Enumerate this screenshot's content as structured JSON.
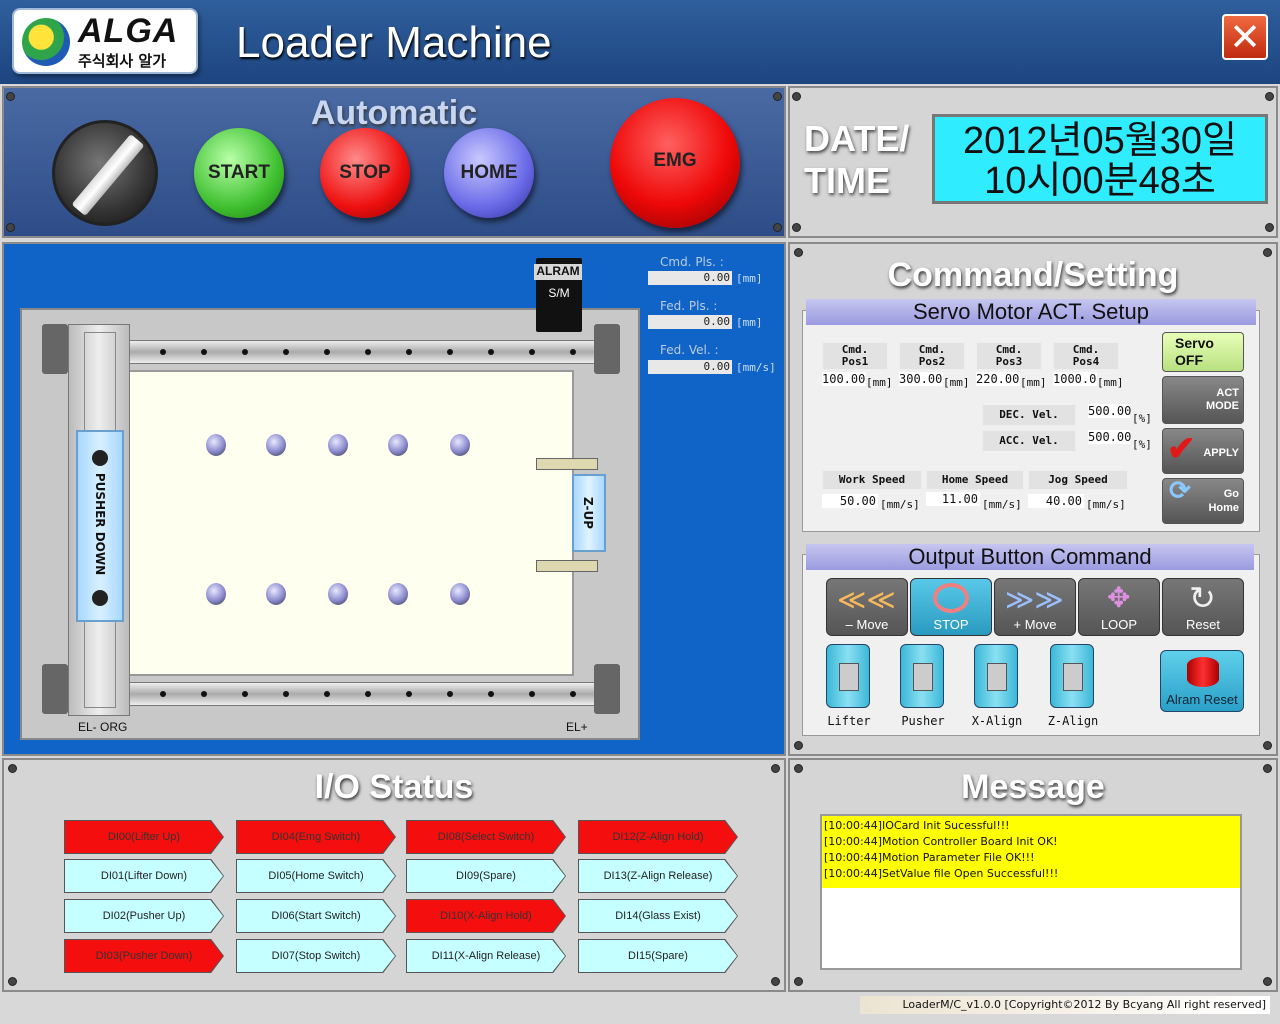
{
  "header": {
    "logo_text": "ALGA",
    "logo_sub": "주식회사 알가",
    "title": "Loader Machine",
    "close_icon": "close-icon"
  },
  "auto": {
    "title": "Automatic",
    "start": "START",
    "stop": "STOP",
    "home": "HOME",
    "emg": "EMG"
  },
  "date": {
    "label1": "DATE/",
    "label2": "TIME",
    "line1": "2012년05월30일",
    "line2": "10시00분48초"
  },
  "machine": {
    "alarm": "ALRAM",
    "sm": "S/M",
    "pusher": "PUSHER DOWN",
    "zup": "Z-UP",
    "el_org": "EL- ORG",
    "el_plus": "EL+",
    "cmd_pls_label": "Cmd. Pls. :",
    "cmd_pls": "0.00",
    "cmd_pls_unit": "[mm]",
    "fed_pls_label": "Fed. Pls. :",
    "fed_pls": "0.00",
    "fed_pls_unit": "[mm]",
    "fed_vel_label": "Fed. Vel. :",
    "fed_vel": "0.00",
    "fed_vel_unit": "[mm/s]"
  },
  "command": {
    "title": "Command/Setting",
    "servo_hdr": "Servo Motor ACT. Setup",
    "pos": [
      {
        "label": "Cmd.\nPos1",
        "value": "100.00",
        "unit": "[mm]"
      },
      {
        "label": "Cmd.\nPos2",
        "value": "300.00",
        "unit": "[mm]"
      },
      {
        "label": "Cmd.\nPos3",
        "value": "220.00",
        "unit": "[mm]"
      },
      {
        "label": "Cmd.\nPos4",
        "value": "1000.0(",
        "unit": "[mm]"
      }
    ],
    "dec_label": "DEC. Vel.",
    "dec_value": "500.00",
    "dec_unit": "[%]",
    "acc_label": "ACC. Vel.",
    "acc_value": "500.00",
    "acc_unit": "[%]",
    "work_label": "Work Speed",
    "work_value": "50.00",
    "work_unit": "[mm/s]",
    "home_label": "Home Speed",
    "home_value": "11.00",
    "home_unit": "[mm/s]",
    "jog_label": "Jog Speed",
    "jog_value": "40.00",
    "jog_unit": "[mm/s]",
    "servo_off": "Servo\nOFF",
    "act_mode": "ACT\nMODE",
    "apply": "APPLY",
    "go_home": "Go\nHome",
    "output_hdr": "Output Button Command",
    "move_minus": "– Move",
    "stop": "STOP",
    "move_plus": "+ Move",
    "loop": "LOOP",
    "reset": "Reset",
    "lifter": "Lifter",
    "pusher": "Pusher",
    "xalign": "X-Align",
    "zalign": "Z-Align",
    "alarm_reset": "Alram Reset"
  },
  "io": {
    "title": "I/O Status",
    "items": [
      {
        "label": "DI00(Lifter Up)",
        "on": true
      },
      {
        "label": "DI01(Lifter Down)",
        "on": false
      },
      {
        "label": "DI02(Pusher Up)",
        "on": false
      },
      {
        "label": "DI03(Pusher Down)",
        "on": true
      },
      {
        "label": "DI04(Emg Switch)",
        "on": true
      },
      {
        "label": "DI05(Home Switch)",
        "on": false
      },
      {
        "label": "DI06(Start Switch)",
        "on": false
      },
      {
        "label": "DI07(Stop Switch)",
        "on": false
      },
      {
        "label": "DI08(Select Switch)",
        "on": true
      },
      {
        "label": "DI09(Spare)",
        "on": false
      },
      {
        "label": "DI10(X-Align Hold)",
        "on": true
      },
      {
        "label": "DI11(X-Align Release)",
        "on": false
      },
      {
        "label": "DI12(Z-Align Hold)",
        "on": true
      },
      {
        "label": "DI13(Z-Align Release)",
        "on": false
      },
      {
        "label": "DI14(Glass Exist)",
        "on": false
      },
      {
        "label": "DI15(Spare)",
        "on": false
      }
    ]
  },
  "message": {
    "title": "Message",
    "lines": [
      "[10:00:44]IOCard Init Sucessful!!!",
      "[10:00:44]Motion Controller Board Init OK!",
      "[10:00:44]Motion Parameter File OK!!!",
      "[10:00:44]SetValue file Open Successful!!!"
    ]
  },
  "footer": "LoaderM/C_v1.0.0 [Copyright©2012 By Bcyang All right reserved]"
}
